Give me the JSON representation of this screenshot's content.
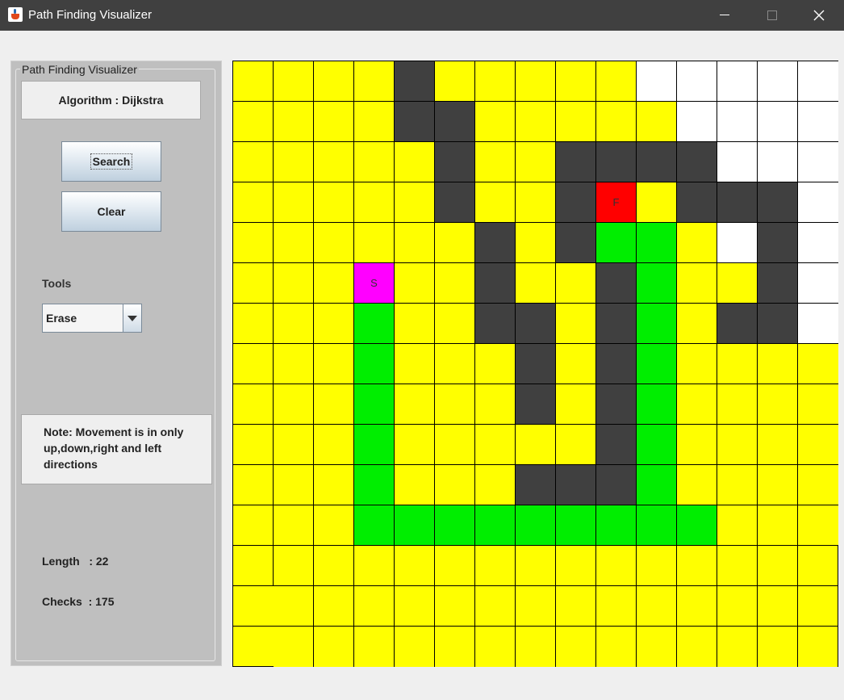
{
  "window": {
    "title": "Path Finding Visualizer"
  },
  "panel": {
    "group_label": "Path Finding Visualizer",
    "algorithm_text": "Algorithm :  Dijkstra",
    "search_label": "Search",
    "clear_label": "Clear",
    "tools_label": "Tools",
    "tool_selected": "Erase",
    "note": "Note: Movement is in only up,down,right and left directions",
    "length_text": "Length   : 22",
    "checks_text": "Checks  : 175"
  },
  "grid": {
    "rows": 15,
    "cols": 15,
    "legend": {
      "e": "#ffff00",
      "u": "#ffffff",
      "w": "#404040",
      "p": "#00ee00",
      "s": "#ff00ff",
      "f": "#ff0000"
    },
    "start_label": "S",
    "finish_label": "F",
    "cells": [
      "eeeeweeeeeuuuuu",
      "eeeewweeeeeuuuu",
      "eeeeeweewwwwuuu",
      "eeeeeweewfewwwu",
      "eeeeeewewppeuwu",
      "eeeseeweewpeewu",
      "eeepeewwewpewwu",
      "eeepeeewewpeeee",
      "eeepeeewewpeeee",
      "eeepeeeeewpeeee",
      "eeepeeewwwpeeee",
      "eeepppppppppeeee",
      "eeeeeeeeeeeeeee",
      "eeeeeeeeeeeeeee",
      "eeeeeeeeeeeeeee"
    ]
  }
}
